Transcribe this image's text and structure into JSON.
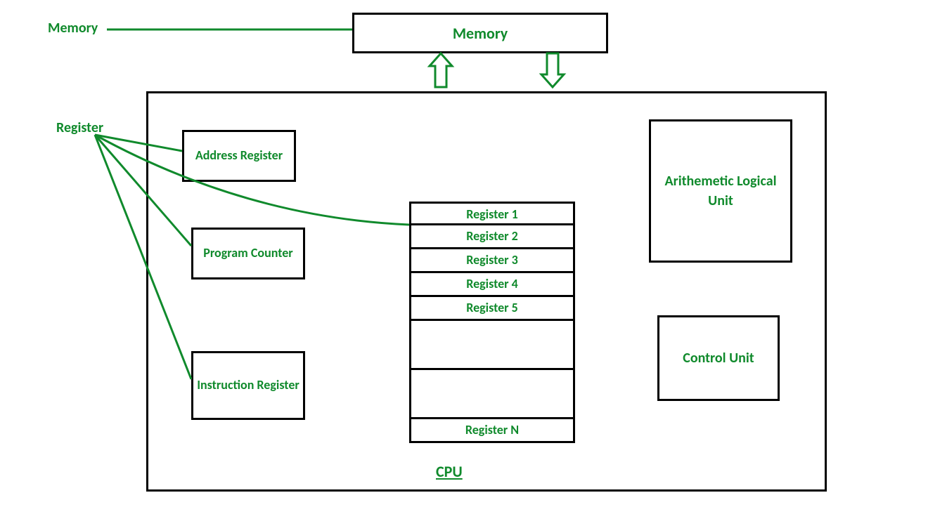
{
  "labels": {
    "memory_side": "Memory",
    "register_side": "Register",
    "cpu": "CPU"
  },
  "boxes": {
    "memory": "Memory",
    "address_register": "Address Register",
    "program_counter": "Program Counter",
    "instruction_register": "Instruction Register",
    "alu": "Arithemetic Logical Unit",
    "control_unit": "Control Unit"
  },
  "register_file": {
    "rows": [
      "Register 1",
      "Register 2",
      "Register 3",
      "Register 4",
      "Register 5",
      "",
      "",
      "Register N"
    ]
  },
  "colors": {
    "accent": "#108a2c",
    "border": "#000000"
  }
}
